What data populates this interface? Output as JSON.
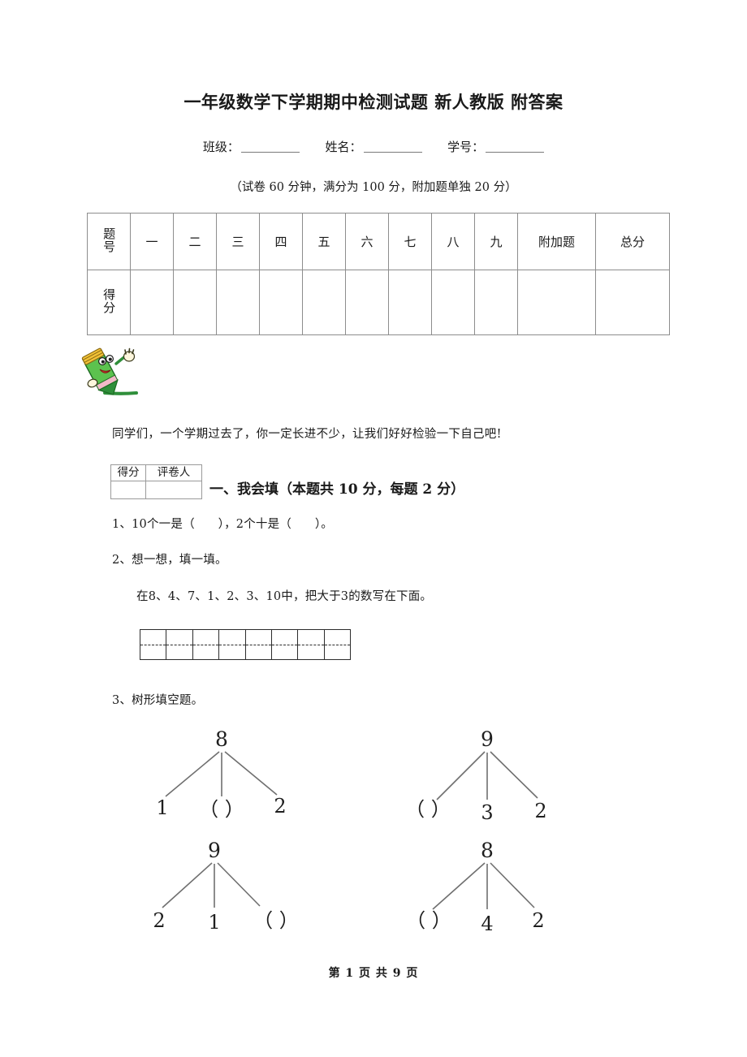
{
  "document": {
    "title": "一年级数学下学期期中检测试题 新人教版 附答案",
    "exam_note": "（试卷 60 分钟，满分为 100 分，附加题单独 20 分）",
    "greeting": "同学们，一个学期过去了，你一定长进不少，让我们好好检验一下自己吧!",
    "footer": "第 1 页 共 9 页"
  },
  "identity": {
    "class_label": "班级：",
    "name_label": "姓名：",
    "student_id_label": "学号："
  },
  "score_table": {
    "row_header_question": "题号",
    "row_header_score": "得分",
    "columns": [
      "一",
      "二",
      "三",
      "四",
      "五",
      "六",
      "七",
      "八",
      "九",
      "附加题",
      "总分"
    ],
    "scores": [
      "",
      "",
      "",
      "",
      "",
      "",
      "",
      "",
      "",
      "",
      ""
    ]
  },
  "grader_box": {
    "score_label": "得分",
    "reviewer_label": "评卷人",
    "score_value": "",
    "reviewer_value": ""
  },
  "section": {
    "heading": "一、我会填（本题共 10 分，每题 2 分）"
  },
  "questions": {
    "q1": "1、10个一是（      ），2个十是（      ）。",
    "q2": "2、想一想，填一填。",
    "q2_sub": "在8、4、7、1、2、3、10中，把大于3的数写在下面。",
    "q3": "3、树形填空题。"
  },
  "number_grid": {
    "cell_count": 8,
    "values": [
      "",
      "",
      "",
      "",
      "",
      "",
      "",
      ""
    ]
  },
  "trees": [
    {
      "root": "8",
      "leaves": [
        "1",
        "（   ）",
        "2"
      ]
    },
    {
      "root": "9",
      "leaves": [
        "（   ）",
        "3",
        "2"
      ]
    },
    {
      "root": "9",
      "leaves": [
        "2",
        "1",
        "（   ）"
      ]
    },
    {
      "root": "8",
      "leaves": [
        "（   ）",
        "4",
        "2"
      ]
    }
  ],
  "colors": {
    "text": "#1a1a1a",
    "table_border": "#8d8d8d",
    "grid_border": "#2c2c2c",
    "branch": "#6f6f6f",
    "mascot_body": "#49b24a",
    "mascot_cap": "#f2c237"
  }
}
